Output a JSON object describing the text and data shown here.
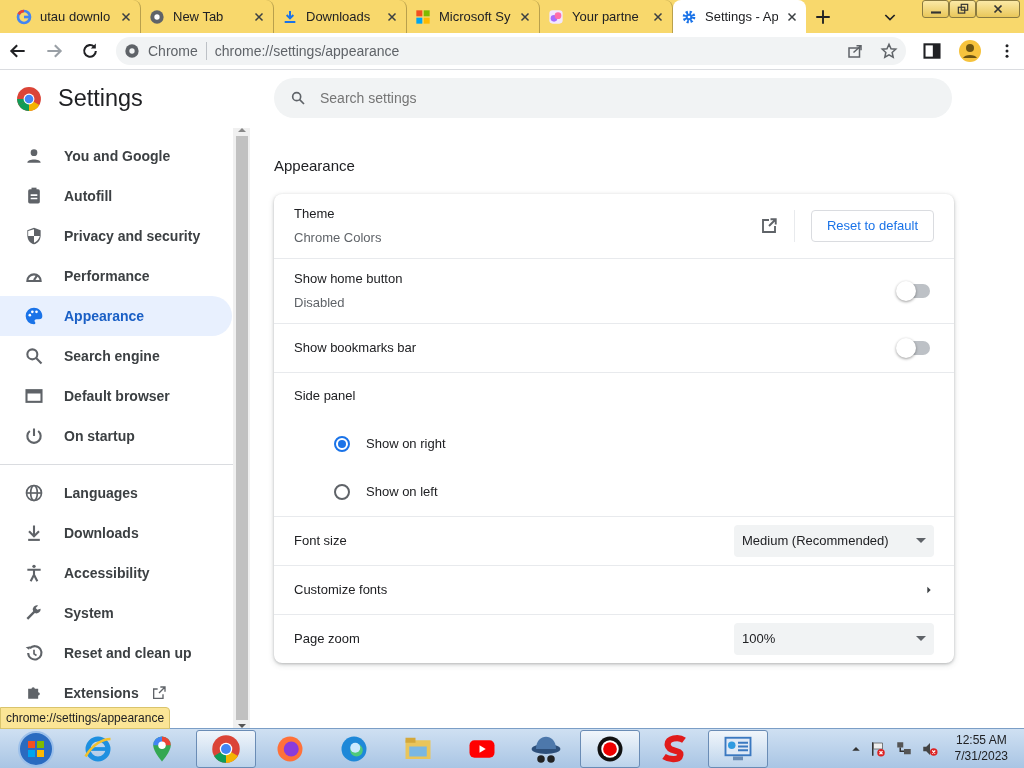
{
  "tabs": [
    {
      "title": "utau downlo",
      "selected": false
    },
    {
      "title": "New Tab",
      "selected": false
    },
    {
      "title": "Downloads",
      "selected": false
    },
    {
      "title": "Microsoft Sy",
      "selected": false
    },
    {
      "title": "Your partne",
      "selected": false
    },
    {
      "title": "Settings - Ap",
      "selected": true
    }
  ],
  "omnibox": {
    "site": "Chrome",
    "url": "chrome://settings/appearance"
  },
  "settings_title": "Settings",
  "search": {
    "placeholder": "Search settings"
  },
  "sidebar": {
    "groups": [
      [
        {
          "label": "You and Google",
          "selected": false
        },
        {
          "label": "Autofill",
          "selected": false
        },
        {
          "label": "Privacy and security",
          "selected": false
        },
        {
          "label": "Performance",
          "selected": false
        },
        {
          "label": "Appearance",
          "selected": true
        },
        {
          "label": "Search engine",
          "selected": false
        },
        {
          "label": "Default browser",
          "selected": false
        },
        {
          "label": "On startup",
          "selected": false
        }
      ],
      [
        {
          "label": "Languages",
          "selected": false
        },
        {
          "label": "Downloads",
          "selected": false
        },
        {
          "label": "Accessibility",
          "selected": false
        },
        {
          "label": "System",
          "selected": false
        },
        {
          "label": "Reset and clean up",
          "selected": false
        },
        {
          "label": "Extensions",
          "selected": false
        }
      ]
    ]
  },
  "section_title": "Appearance",
  "rows": [
    {
      "kind": "theme",
      "label": "Theme",
      "sublabel": "Chrome Colors",
      "button": "Reset to default"
    },
    {
      "kind": "toggle",
      "label": "Show home button",
      "sublabel": "Disabled",
      "on": false
    },
    {
      "kind": "toggle",
      "label": "Show bookmarks bar",
      "on": false
    },
    {
      "kind": "heading",
      "label": "Side panel"
    },
    {
      "kind": "radio",
      "label": "Show on right",
      "selected": true
    },
    {
      "kind": "radio",
      "label": "Show on left",
      "selected": false
    },
    {
      "kind": "select",
      "label": "Font size",
      "value": "Medium (Recommended)"
    },
    {
      "kind": "link",
      "label": "Customize fonts"
    },
    {
      "kind": "select",
      "label": "Page zoom",
      "value": "100%"
    }
  ],
  "status_bubble": "chrome://settings/appearance",
  "taskbar": [
    {
      "selected": false
    },
    {
      "selected": false
    },
    {
      "selected": true
    },
    {
      "selected": false
    },
    {
      "selected": false
    },
    {
      "selected": false
    },
    {
      "selected": false
    },
    {
      "selected": false
    },
    {
      "selected": true
    },
    {
      "selected": false
    },
    {
      "selected": true
    }
  ],
  "clock": {
    "time": "12:55 AM",
    "date": "7/31/2023"
  }
}
